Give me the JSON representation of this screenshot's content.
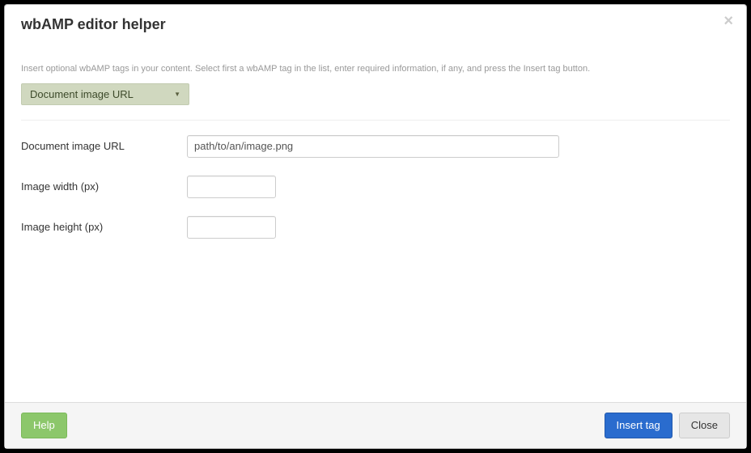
{
  "modal": {
    "title": "wbAMP editor helper",
    "instructions": "Insert optional wbAMP tags in your content. Select first a wbAMP tag in the list, enter required information, if any, and press the Insert tag button."
  },
  "select": {
    "selected_label": "Document image URL"
  },
  "form": {
    "url": {
      "label": "Document image URL",
      "value": "path/to/an/image.png"
    },
    "width": {
      "label": "Image width (px)",
      "value": ""
    },
    "height": {
      "label": "Image height (px)",
      "value": ""
    }
  },
  "footer": {
    "help_label": "Help",
    "insert_label": "Insert tag",
    "close_label": "Close"
  }
}
